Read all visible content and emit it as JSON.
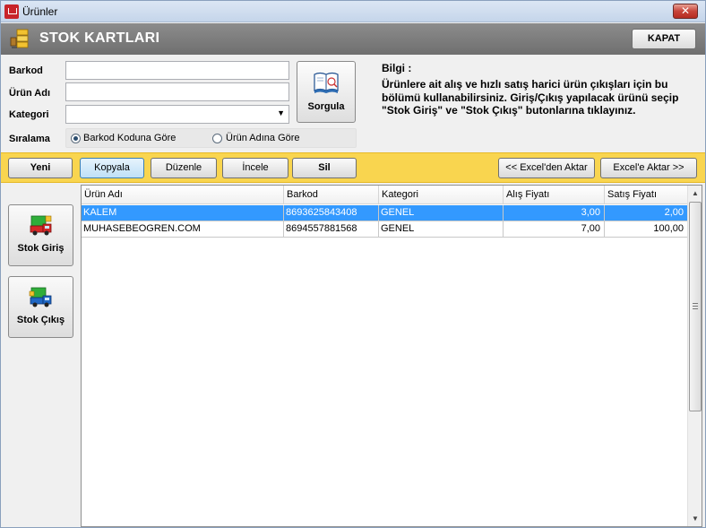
{
  "window": {
    "title": "Ürünler",
    "close_symbol": "✕"
  },
  "header": {
    "title": "STOK KARTLARI",
    "close_label": "KAPAT"
  },
  "form": {
    "barkod_label": "Barkod",
    "barkod_value": "",
    "urun_adi_label": "Ürün Adı",
    "urun_adi_value": "",
    "kategori_label": "Kategori",
    "kategori_value": "",
    "siralama_label": "Sıralama",
    "sort_options": [
      {
        "label": "Barkod Koduna  Göre",
        "checked": true
      },
      {
        "label": "Ürün Adına Göre",
        "checked": false
      }
    ],
    "query_button": "Sorgula"
  },
  "info": {
    "title": "Bilgi :",
    "text": "Ürünlere ait alış ve hızlı satış harici ürün çıkışları için bu bölümü kullanabilirsiniz. Giriş/Çıkış yapılacak ürünü seçip \"Stok Giriş\" ve \"Stok Çıkış\" butonlarına tıklayınız."
  },
  "toolbar": {
    "new": "Yeni",
    "copy": "Kopyala",
    "edit": "Düzenle",
    "inspect": "İncele",
    "delete": "Sil",
    "import_excel": "<< Excel'den Aktar",
    "export_excel": "Excel'e Aktar >>"
  },
  "side": {
    "stock_in": "Stok Giriş",
    "stock_out": "Stok Çıkış"
  },
  "grid": {
    "columns": [
      "Ürün Adı",
      "Barkod",
      "Kategori",
      "Alış Fiyatı",
      "Satış Fiyatı"
    ],
    "rows": [
      {
        "name": "KALEM",
        "barcode": "8693625843408",
        "category": "GENEL",
        "buy": "3,00",
        "sell": "2,00",
        "selected": true
      },
      {
        "name": "MUHASEBEOGREN.COM",
        "barcode": "8694557881568",
        "category": "GENEL",
        "buy": "7,00",
        "sell": "100,00",
        "selected": false
      }
    ]
  },
  "colors": {
    "toolbar": "#f9d54f",
    "header": "#7d7d7d",
    "selection": "#3399ff"
  }
}
